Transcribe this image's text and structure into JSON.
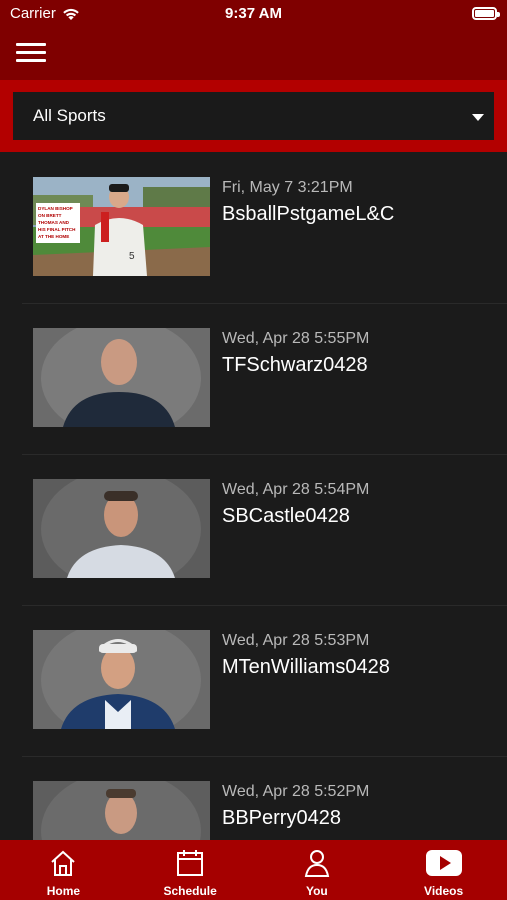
{
  "status_bar": {
    "carrier": "Carrier",
    "time": "9:37 AM"
  },
  "nav": {
    "menu_icon": "hamburger-menu-icon"
  },
  "filter": {
    "selected": "All Sports"
  },
  "videos": [
    {
      "date": "Fri, May 7 3:21PM",
      "title": "BsballPstgameL&C",
      "thumbnail": "baseball-player-interview",
      "thumb_caption": [
        "DYLAN BISHOP",
        "ON BRETT",
        "THOMAS AND",
        "HIS FINAL PITCH",
        "AT THE HOME"
      ]
    },
    {
      "date": "Wed, Apr 28 5:55PM",
      "title": "TFSchwarz0428",
      "thumbnail": "coach-headshot"
    },
    {
      "date": "Wed, Apr 28 5:54PM",
      "title": "SBCastle0428",
      "thumbnail": "coach-headshot"
    },
    {
      "date": "Wed, Apr 28 5:53PM",
      "title": "MTenWilliams0428",
      "thumbnail": "coach-headshot"
    },
    {
      "date": "Wed, Apr 28 5:52PM",
      "title": "BBPerry0428",
      "thumbnail": "coach-headshot"
    }
  ],
  "tabs": [
    {
      "label": "Home",
      "icon": "home-icon"
    },
    {
      "label": "Schedule",
      "icon": "calendar-icon"
    },
    {
      "label": "You",
      "icon": "person-icon"
    },
    {
      "label": "Videos",
      "icon": "play-icon"
    }
  ],
  "colors": {
    "nav_background": "#7f0000",
    "filter_background": "#b30000",
    "tabbar_background": "#a50000",
    "list_background": "#1b1b1b"
  }
}
